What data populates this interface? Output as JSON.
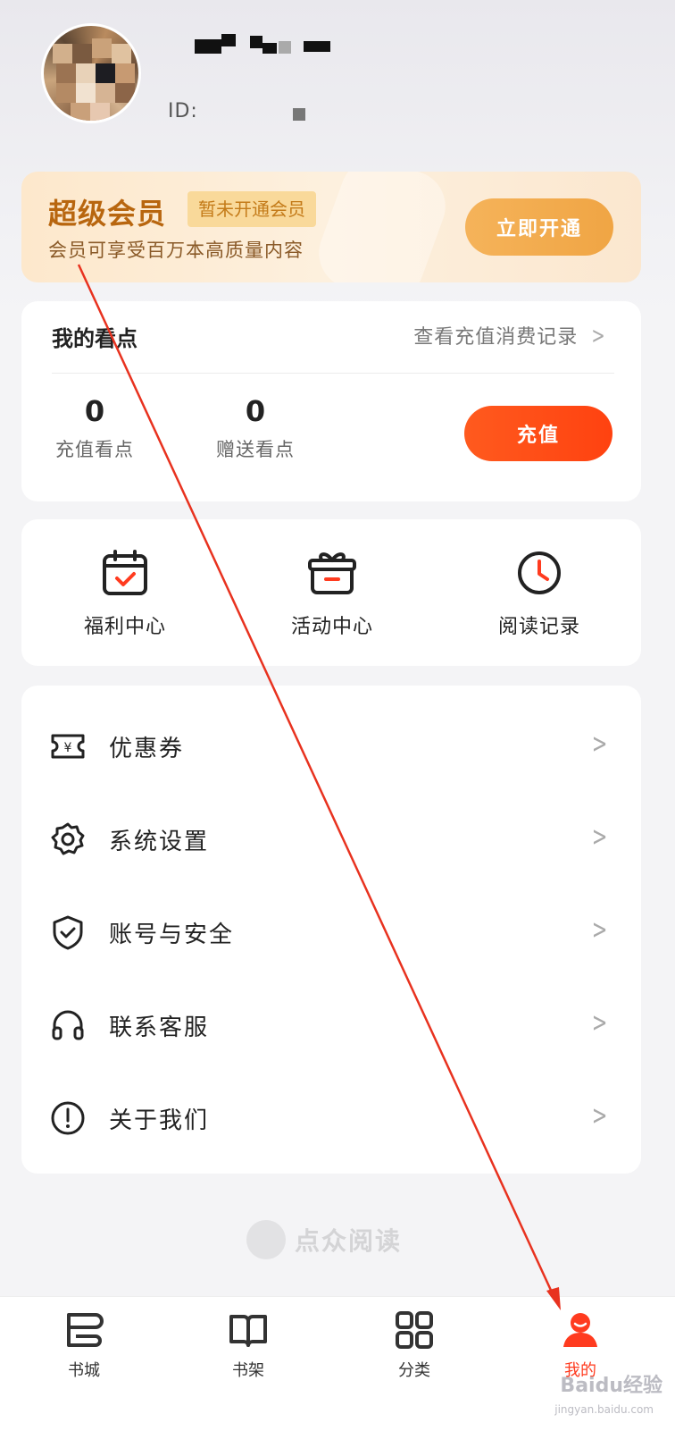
{
  "profile": {
    "id_label": "ID:"
  },
  "vip": {
    "title": "超级会员",
    "status": "暂未开通会员",
    "subtitle": "会员可享受百万本高质量内容",
    "button": "立即开通"
  },
  "points": {
    "title": "我的看点",
    "link": "查看充值消费记录",
    "recharge_value": "0",
    "recharge_label": "充值看点",
    "gift_value": "0",
    "gift_label": "赠送看点",
    "button": "充值"
  },
  "quick": [
    {
      "label": "福利中心",
      "icon": "calendar-check-icon"
    },
    {
      "label": "活动中心",
      "icon": "gift-icon"
    },
    {
      "label": "阅读记录",
      "icon": "clock-icon"
    }
  ],
  "menu": [
    {
      "label": "优惠券",
      "icon": "coupon-icon"
    },
    {
      "label": "系统设置",
      "icon": "gear-icon"
    },
    {
      "label": "账号与安全",
      "icon": "shield-icon"
    },
    {
      "label": "联系客服",
      "icon": "headset-icon"
    },
    {
      "label": "关于我们",
      "icon": "info-icon"
    }
  ],
  "brand": {
    "name": "点众阅读"
  },
  "tabbar": [
    {
      "label": "书城",
      "icon": "bookstore-icon",
      "active": false
    },
    {
      "label": "书架",
      "icon": "book-icon",
      "active": false
    },
    {
      "label": "分类",
      "icon": "grid-icon",
      "active": false
    },
    {
      "label": "我的",
      "icon": "user-icon",
      "active": true
    }
  ],
  "watermark": {
    "text": "Baidu经验",
    "sub": "jingyan.baidu.com"
  },
  "colors": {
    "accent": "#ff4210",
    "vip_gold": "#b8660f",
    "vip_button": "#f0a544"
  }
}
